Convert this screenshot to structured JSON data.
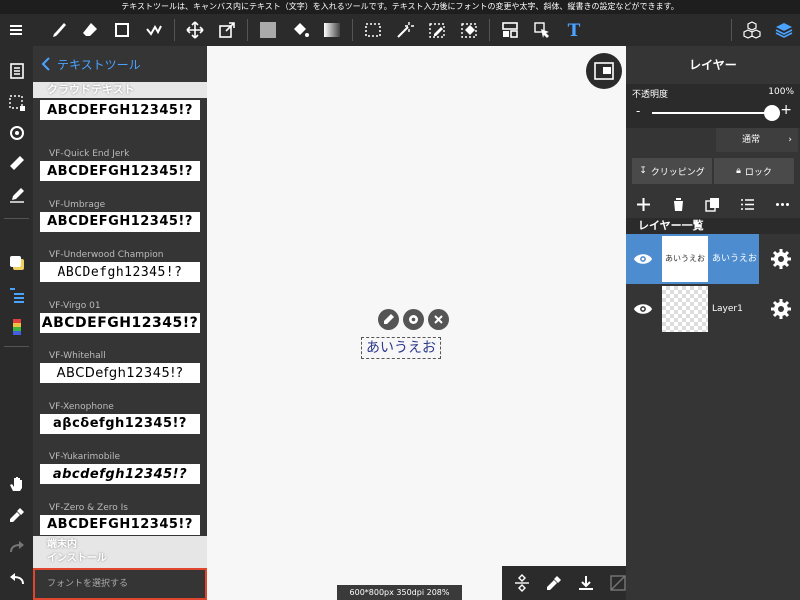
{
  "info_text": "テキストツールは、キャンバス内にテキスト（文字）を入れるツールです。テキスト入力後にフォントの変更や太字、斜体、縦書きの設定などができます。",
  "toolbar": {
    "icons": [
      "menu-icon",
      "brush-icon",
      "eraser-icon",
      "fill-shape-icon",
      "snap-icon",
      "move-icon",
      "transform-icon",
      "color-icon",
      "bucket-icon",
      "gradient-icon",
      "select-icon",
      "magic-wand-icon",
      "select-pen-icon",
      "select-eraser-icon",
      "panel-icon",
      "pointer-icon",
      "text-icon",
      "materials-icon",
      "layers-icon"
    ]
  },
  "font_panel": {
    "back_label": "テキストツール",
    "section_cloud": "クラウドテキスト",
    "fonts": [
      {
        "name": "",
        "sample": "ABCDEFGH12345!?"
      },
      {
        "name": "VF-Quick End Jerk",
        "sample": "ABCDEFGH12345!?"
      },
      {
        "name": "VF-Umbrage",
        "sample": "ABCDEFGH12345!?"
      },
      {
        "name": "VF-Underwood Champion",
        "sample": "ABCDefgh12345!?"
      },
      {
        "name": "VF-Virgo 01",
        "sample": "ABCDEFGH12345!?"
      },
      {
        "name": "VF-Whitehall",
        "sample": "ABCDefgh12345!?"
      },
      {
        "name": "VF-Xenophone",
        "sample": "aβcδefgh12345!?"
      },
      {
        "name": "VF-Yukarimobile",
        "sample": "abcdefgh12345!?"
      },
      {
        "name": "VF-Zero & Zero Is",
        "sample": "ABCDEFGH12345!?"
      }
    ],
    "section_local_1": "端末内",
    "section_local_2": "インストール",
    "select_font": "フォントを選択する"
  },
  "canvas": {
    "text_content": "あいうえお",
    "status": "600*800px 350dpi 208%"
  },
  "layers_panel": {
    "title": "レイヤー",
    "opacity_label": "不透明度",
    "opacity_value": "100%",
    "opacity_fraction": 1.0,
    "minus": "-",
    "plus": "+",
    "blend_mode": "通常",
    "clipping": "クリッピング",
    "lock": "ロック",
    "list_header": "レイヤー一覧",
    "layers": [
      {
        "thumb_text": "あいうえお",
        "name": "あいうえお",
        "selected": true
      },
      {
        "thumb_text": "",
        "name": "Layer1",
        "selected": false
      }
    ]
  },
  "colors": {
    "accent": "#4d8ccf",
    "link": "#4aa3ff",
    "highlight_border": "#e0462e",
    "text_blue": "#2d3a8c"
  }
}
